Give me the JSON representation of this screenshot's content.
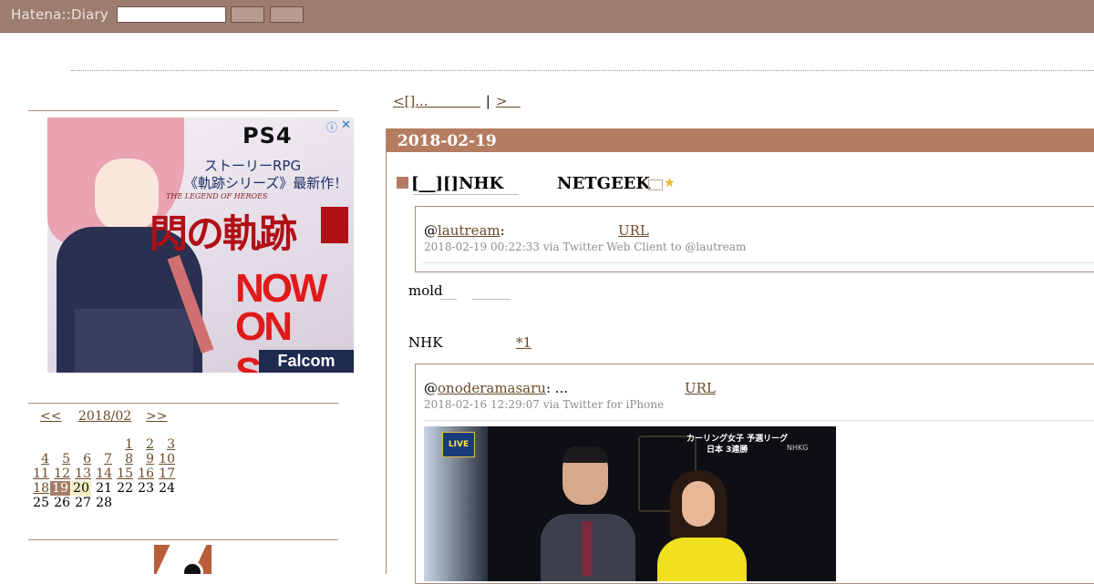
{
  "topbar": {
    "logo": "Hatena::Diary",
    "search_value": "",
    "button1_label": "",
    "button2_label": ""
  },
  "colors": {
    "topbar": "#9c7d70",
    "accent": "#b47d62",
    "link": "#6a4a2a",
    "rule": "#b08a78"
  },
  "ad": {
    "brand": "PS4",
    "line1": "ストーリーRPG",
    "line2": "《軌跡シリーズ》最新作！",
    "subtitle": "THE LEGEND OF HEROES",
    "title": "閃の軌跡",
    "sale_line1": "NOW",
    "sale_line2": "ON SALE",
    "logo": "Falcom",
    "info_icon": "ⓘ",
    "close_icon": "✕"
  },
  "calendar": {
    "prev": "<<",
    "month": "2018/02",
    "next": ">>",
    "weeks": [
      [
        "",
        "",
        "",
        "",
        "1",
        "2",
        "3"
      ],
      [
        "4",
        "5",
        "6",
        "7",
        "8",
        "9",
        "10"
      ],
      [
        "11",
        "12",
        "13",
        "14",
        "15",
        "16",
        "17"
      ],
      [
        "18",
        "19",
        "20",
        "21",
        "22",
        "23",
        "24"
      ],
      [
        "25",
        "26",
        "27",
        "28",
        "",
        "",
        ""
      ]
    ],
    "linked_until": 19,
    "selected": "19",
    "today": "20"
  },
  "pager": {
    "prev": "<[]...            ",
    "separator": "|",
    "next": ">   "
  },
  "entry": {
    "date": "2018-02-19",
    "square": "■",
    "title": "[__][]NHK",
    "tag": "NETGEEK",
    "star": "★"
  },
  "tweets": [
    {
      "at": "@",
      "user": "lautream",
      "colon": ":",
      "url_label": "URL",
      "meta": "2018-02-19 00:22:33 via Twitter Web Client to @lautream"
    },
    {
      "at": "@",
      "user": "onoderamasaru",
      "colon": ": ...",
      "url_label": "URL",
      "meta": "2018-02-16 12:29:07 via Twitter for iPhone",
      "photo": {
        "live_badge": "LIVE",
        "caption_line1": "カーリング女子 予選リーグ",
        "caption_line2": "日本 3連勝",
        "channel": "NHKG"
      }
    }
  ],
  "body": {
    "mold": "mold",
    "nhk": "NHK",
    "footnote": "*1"
  }
}
